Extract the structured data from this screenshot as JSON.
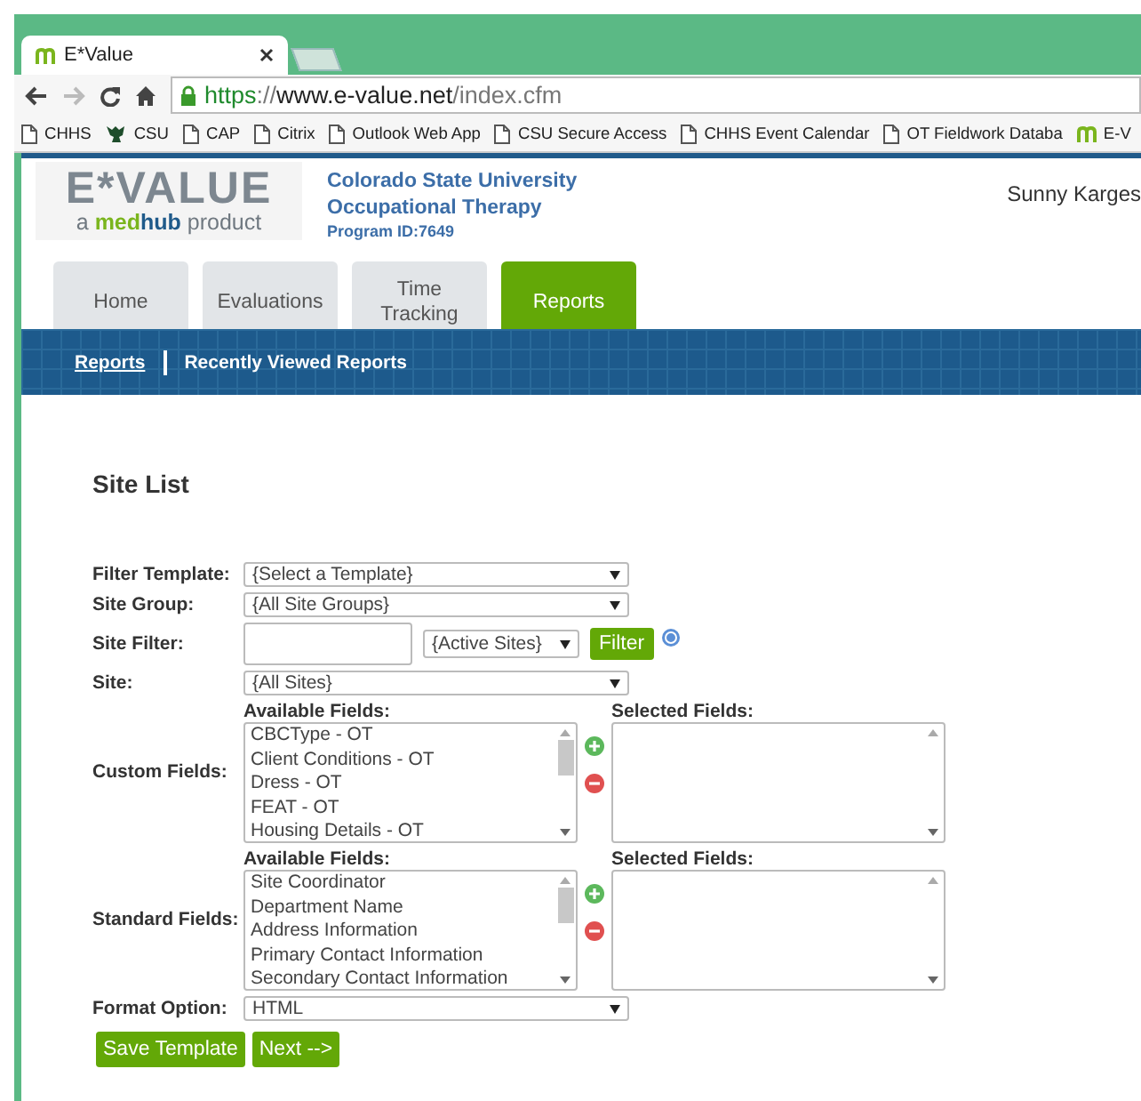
{
  "browser": {
    "tab_title": "E*Value",
    "url_scheme": "https",
    "url_rest": "://",
    "url_host": "www.e-value.net",
    "url_path": "/index.cfm",
    "bookmarks": [
      {
        "label": "CHHS",
        "kind": "page"
      },
      {
        "label": "CSU",
        "kind": "logo"
      },
      {
        "label": "CAP",
        "kind": "page"
      },
      {
        "label": "Citrix",
        "kind": "page"
      },
      {
        "label": "Outlook Web App",
        "kind": "page"
      },
      {
        "label": "CSU Secure Access",
        "kind": "page"
      },
      {
        "label": "CHHS Event Calendar",
        "kind": "page"
      },
      {
        "label": "OT Fieldwork Databa",
        "kind": "page"
      },
      {
        "label": "E-V",
        "kind": "brand"
      }
    ]
  },
  "header": {
    "logo": {
      "wordmark": "E*VALUE",
      "tagline_prefix": "a",
      "brand_first": "med",
      "brand_second": "hub",
      "tagline_suffix": "product"
    },
    "org_lines": [
      "Colorado State University",
      "Occupational Therapy"
    ],
    "program_id": "Program ID:7649",
    "user": "Sunny Karges"
  },
  "tabs": [
    {
      "label": "Home",
      "selected": false
    },
    {
      "label": "Evaluations",
      "selected": false
    },
    {
      "label": "Time Tracking",
      "selected": false
    },
    {
      "label": "Reports",
      "selected": true
    }
  ],
  "subnav": [
    {
      "label": "Reports",
      "selected": true
    },
    {
      "label": "Recently Viewed Reports",
      "selected": false
    }
  ],
  "page_title": "Site List",
  "form": [
    {
      "kind": "select",
      "label": "Filter Template:",
      "value": "{Select a Template}"
    },
    {
      "kind": "select",
      "label": "Site Group:",
      "value": "{All Site Groups}"
    },
    {
      "kind": "filter",
      "label": "Site Filter:",
      "status": "{Active Sites}",
      "button": "Filter"
    },
    {
      "kind": "select",
      "label": "Site:",
      "value": "{All Sites}"
    },
    {
      "kind": "picker",
      "label": "Custom Fields:",
      "available_title": "Available Fields:",
      "selected_title": "Selected Fields:",
      "available": [
        "CBCType - OT",
        "Client Conditions - OT",
        "Dress - OT",
        "FEAT - OT",
        "Housing Details - OT"
      ]
    },
    {
      "kind": "picker",
      "label": "Standard Fields:",
      "available_title": "Available Fields:",
      "selected_title": "Selected Fields:",
      "available": [
        "Site Coordinator",
        "Department Name",
        "Address Information",
        "Primary Contact Information",
        "Secondary Contact Information"
      ]
    },
    {
      "kind": "select",
      "label": "Format Option:",
      "value": "HTML"
    }
  ],
  "buttons": [
    "Save Template",
    "Next -->"
  ]
}
